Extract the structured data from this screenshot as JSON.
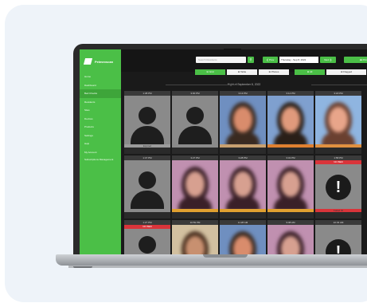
{
  "app": {
    "brand": "Pelmexscan"
  },
  "sidebar": {
    "items": [
      {
        "label": "Home",
        "active": false
      },
      {
        "label": "Dashboard",
        "active": false
      },
      {
        "label": "Bed Checks",
        "active": true
      },
      {
        "label": "Residents",
        "active": false
      },
      {
        "label": "Sites",
        "active": false
      },
      {
        "label": "Devices",
        "active": false
      },
      {
        "label": "Products",
        "active": false
      },
      {
        "label": "Settings",
        "active": false
      },
      {
        "label": "Help",
        "active": false
      },
      {
        "label": "My Account",
        "active": false
      },
      {
        "label": "Subscriptions Management",
        "active": false
      }
    ]
  },
  "toolbar": {
    "search_placeholder": "Search Residents",
    "prev_label": "❮ Prev",
    "date_value": "Thursday - Sep 8, 2022",
    "next_label": "Next ❯",
    "print_label": "🖶 Print"
  },
  "tabs": [
    {
      "label": "⊞ Grid",
      "style": "green"
    },
    {
      "label": "⊞ Table",
      "style": "white"
    },
    {
      "label": "⊞ Photos",
      "style": "white"
    },
    {
      "label": "⊞ All",
      "style": "green"
    },
    {
      "label": "⊞ Flagged",
      "style": "white"
    }
  ],
  "night_title": "Night of September 8, 2022",
  "cells": [
    {
      "time": "1:38 PM",
      "kind": "silhouette",
      "bar": "Expired",
      "bar_color": "#9b9b9b",
      "bg": "#8a8a8a",
      "tag": ""
    },
    {
      "time": "3:00 PM",
      "kind": "silhouette",
      "bar": "",
      "bar_color": "#8a8a8a",
      "bg": "#8a8a8a",
      "tag": ""
    },
    {
      "time": "3:13 PM",
      "kind": "face",
      "bar": "",
      "bar_color": "#c8a070",
      "bg": "#6f8fc0",
      "skin": "#d98c6c",
      "hair": "#3a2a20",
      "tag": ""
    },
    {
      "time": "3:14 PM",
      "kind": "face",
      "bar": "",
      "bar_color": "#e08030",
      "bg": "#7fa0cf",
      "skin": "#e09a7c",
      "hair": "#2a1f18",
      "tag": ""
    },
    {
      "time": "3:18 PM",
      "kind": "face",
      "bar": "",
      "bar_color": "#e09040",
      "bg": "#8fb5e0",
      "skin": "#e8a58a",
      "hair": "#6a4030",
      "tag": ""
    },
    {
      "time": "1:47 PM",
      "kind": "silhouette",
      "bar": "",
      "bar_color": "#8a8a8a",
      "bg": "#8a8a8a",
      "tag": ""
    },
    {
      "time": "3:27 PM",
      "kind": "face",
      "bar": "",
      "bar_color": "#e0a030",
      "bg": "#c090b0",
      "skin": "#d7a090",
      "hair": "#3a2028",
      "tag": ""
    },
    {
      "time": "3:28 PM",
      "kind": "face",
      "bar": "",
      "bar_color": "#e0a030",
      "bg": "#c090b0",
      "skin": "#d7a090",
      "hair": "#3a2028",
      "tag": ""
    },
    {
      "time": "3:32 PM",
      "kind": "face",
      "bar": "",
      "bar_color": "#e0a030",
      "bg": "#c090b0",
      "skin": "#d7a090",
      "hair": "#3a2028",
      "tag": ""
    },
    {
      "time": "1:58 PM",
      "kind": "alert",
      "bar": "Failed ID",
      "bar_color": "#d9343a",
      "bg": "#8a8a8a",
      "tag": "NO BED"
    },
    {
      "time": "1:27 PM",
      "kind": "silhouette",
      "bar": "",
      "bar_color": "#8a8a8a",
      "bg": "#8a8a8a",
      "tag": "NO BED"
    },
    {
      "time": "10:59 PM",
      "kind": "face",
      "bar": "",
      "bar_color": "#8a8a8a",
      "bg": "#d2c0a0",
      "skin": "#c89070",
      "hair": "#4a3020",
      "tag": ""
    },
    {
      "time": "11:28 AM",
      "kind": "face",
      "bar": "",
      "bar_color": "#8a8a8a",
      "bg": "#6f8fc0",
      "skin": "#d98c6c",
      "hair": "#3a2a20",
      "tag": ""
    },
    {
      "time": "9:08 AM",
      "kind": "face",
      "bar": "",
      "bar_color": "#8a8a8a",
      "bg": "#c090b0",
      "skin": "#d7a090",
      "hair": "#3a2028",
      "tag": ""
    },
    {
      "time": "10:33 AM",
      "kind": "alert",
      "bar": "",
      "bar_color": "#8a8a8a",
      "bg": "#8a8a8a",
      "tag": ""
    }
  ]
}
